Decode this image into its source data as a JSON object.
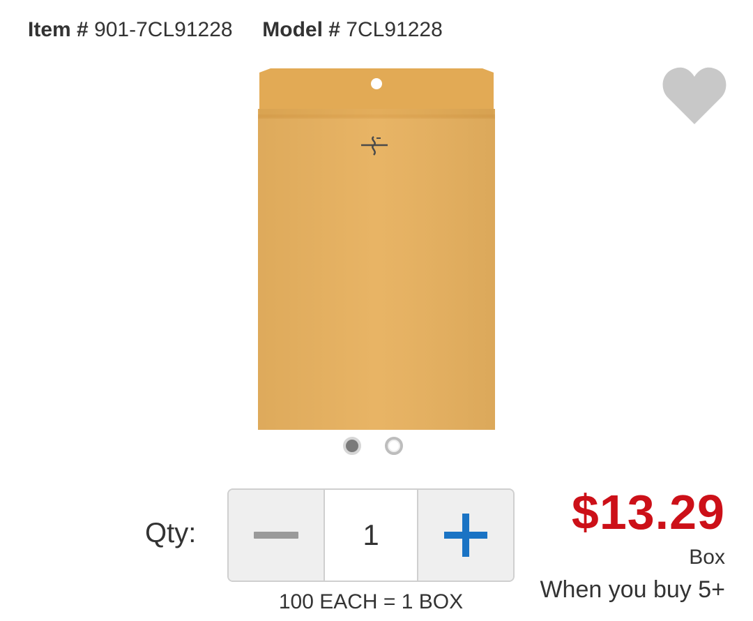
{
  "header": {
    "item_label": "Item #",
    "item_number": "901-7CL91228",
    "model_label": "Model #",
    "model_number": "7CL91228"
  },
  "product": {
    "image_icon": "clasp-envelope-image",
    "envelope_color": "#E7B15F",
    "wishlist_icon": "heart-icon",
    "carousel": {
      "total_images": 2,
      "active_index": 0
    }
  },
  "purchase": {
    "qty_label": "Qty:",
    "quantity": "1",
    "decrement_icon": "minus-icon",
    "increment_icon": "plus-icon",
    "increment_color": "#1a73c4",
    "pack_note": "100 EACH = 1 BOX",
    "price": "$13.29",
    "price_color": "#cc1018",
    "unit": "Box",
    "tier_note": "When you buy 5+"
  }
}
